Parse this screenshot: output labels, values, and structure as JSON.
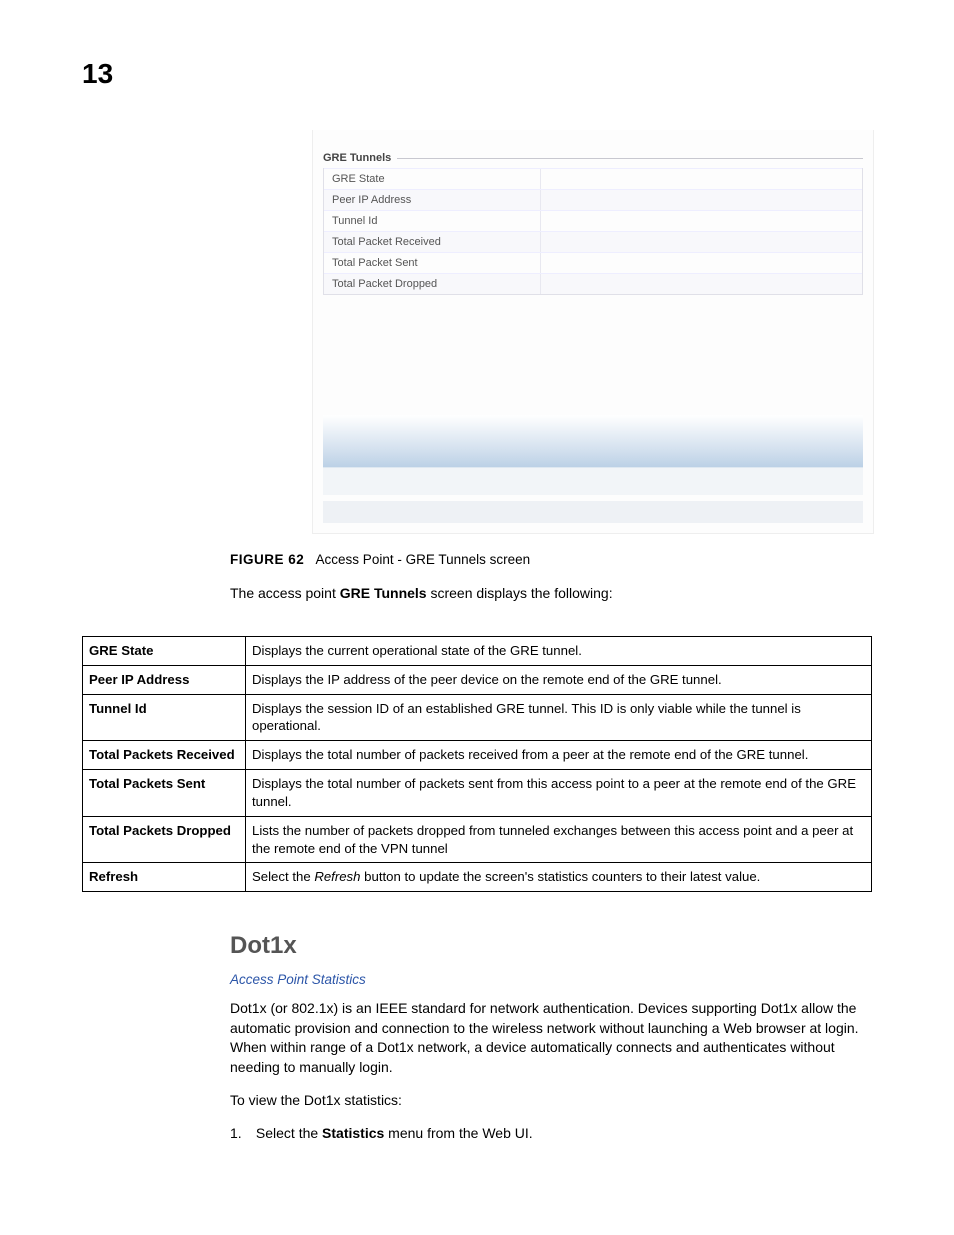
{
  "page_number": "13",
  "screenshot": {
    "group_title": "GRE Tunnels",
    "rows": [
      "GRE State",
      "Peer IP Address",
      "Tunnel Id",
      "Total Packet Received",
      "Total Packet Sent",
      "Total Packet Dropped"
    ]
  },
  "figure": {
    "label": "FIGURE 62",
    "caption": "Access Point - GRE Tunnels screen"
  },
  "intro_prefix": "The access point ",
  "intro_bold": "GRE Tunnels",
  "intro_suffix": " screen displays the following:",
  "def_rows": [
    {
      "term": "GRE State",
      "desc": "Displays the current operational state of the GRE tunnel."
    },
    {
      "term": "Peer IP Address",
      "desc": "Displays the IP address of the peer device on the remote end of the GRE tunnel."
    },
    {
      "term": "Tunnel Id",
      "desc": "Displays the session ID of an established GRE tunnel. This ID is only viable while the tunnel is operational."
    },
    {
      "term": "Total Packets Received",
      "desc": "Displays the total number of packets received from a peer at the remote end of the GRE tunnel."
    },
    {
      "term": "Total Packets Sent",
      "desc": "Displays the total number of packets sent from this access point to a peer at the remote end of the GRE tunnel."
    },
    {
      "term": "Total Packets Dropped",
      "desc": "Lists the number of packets dropped from tunneled exchanges between this access point and a peer at the remote end of the VPN tunnel"
    },
    {
      "term": "Refresh",
      "desc_prefix": "Select the ",
      "desc_italic": "Refresh",
      "desc_suffix": " button to update the screen's statistics counters to their latest value."
    }
  ],
  "section_heading": "Dot1x",
  "breadcrumb": "Access Point Statistics",
  "dot1x_para": "Dot1x (or 802.1x) is an IEEE standard for network authentication. Devices supporting Dot1x allow the automatic provision and connection to the wireless network without launching a Web browser at login. When within range of a Dot1x network, a device automatically connects and authenticates without needing to manually login.",
  "view_stats": "To view the Dot1x statistics:",
  "step_num": "1.",
  "step_prefix": "Select the ",
  "step_bold": "Statistics",
  "step_suffix": " menu from the Web UI."
}
